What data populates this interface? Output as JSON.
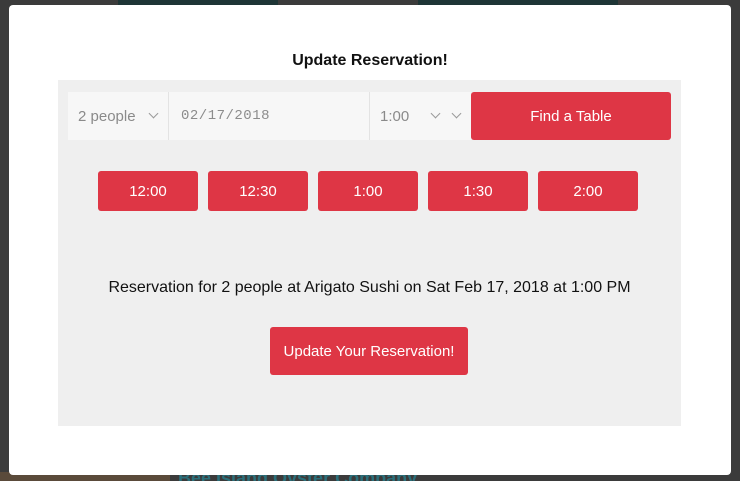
{
  "background": {
    "partial_title": "Bee Island Oyster Company"
  },
  "modal": {
    "title": "Update Reservation!",
    "search": {
      "party_size": "2 people",
      "date": "02/17/2018",
      "time": "1:00",
      "find_label": "Find a Table"
    },
    "time_slots": [
      "12:00",
      "12:30",
      "1:00",
      "1:30",
      "2:00"
    ],
    "summary": "Reservation for 2 people at Arigato Sushi on Sat Feb 17, 2018 at 1:00 PM",
    "update_label": "Update Your Reservation!"
  },
  "colors": {
    "accent": "#de3645",
    "panel": "#efefef",
    "overlay": "#3b3b3b"
  }
}
